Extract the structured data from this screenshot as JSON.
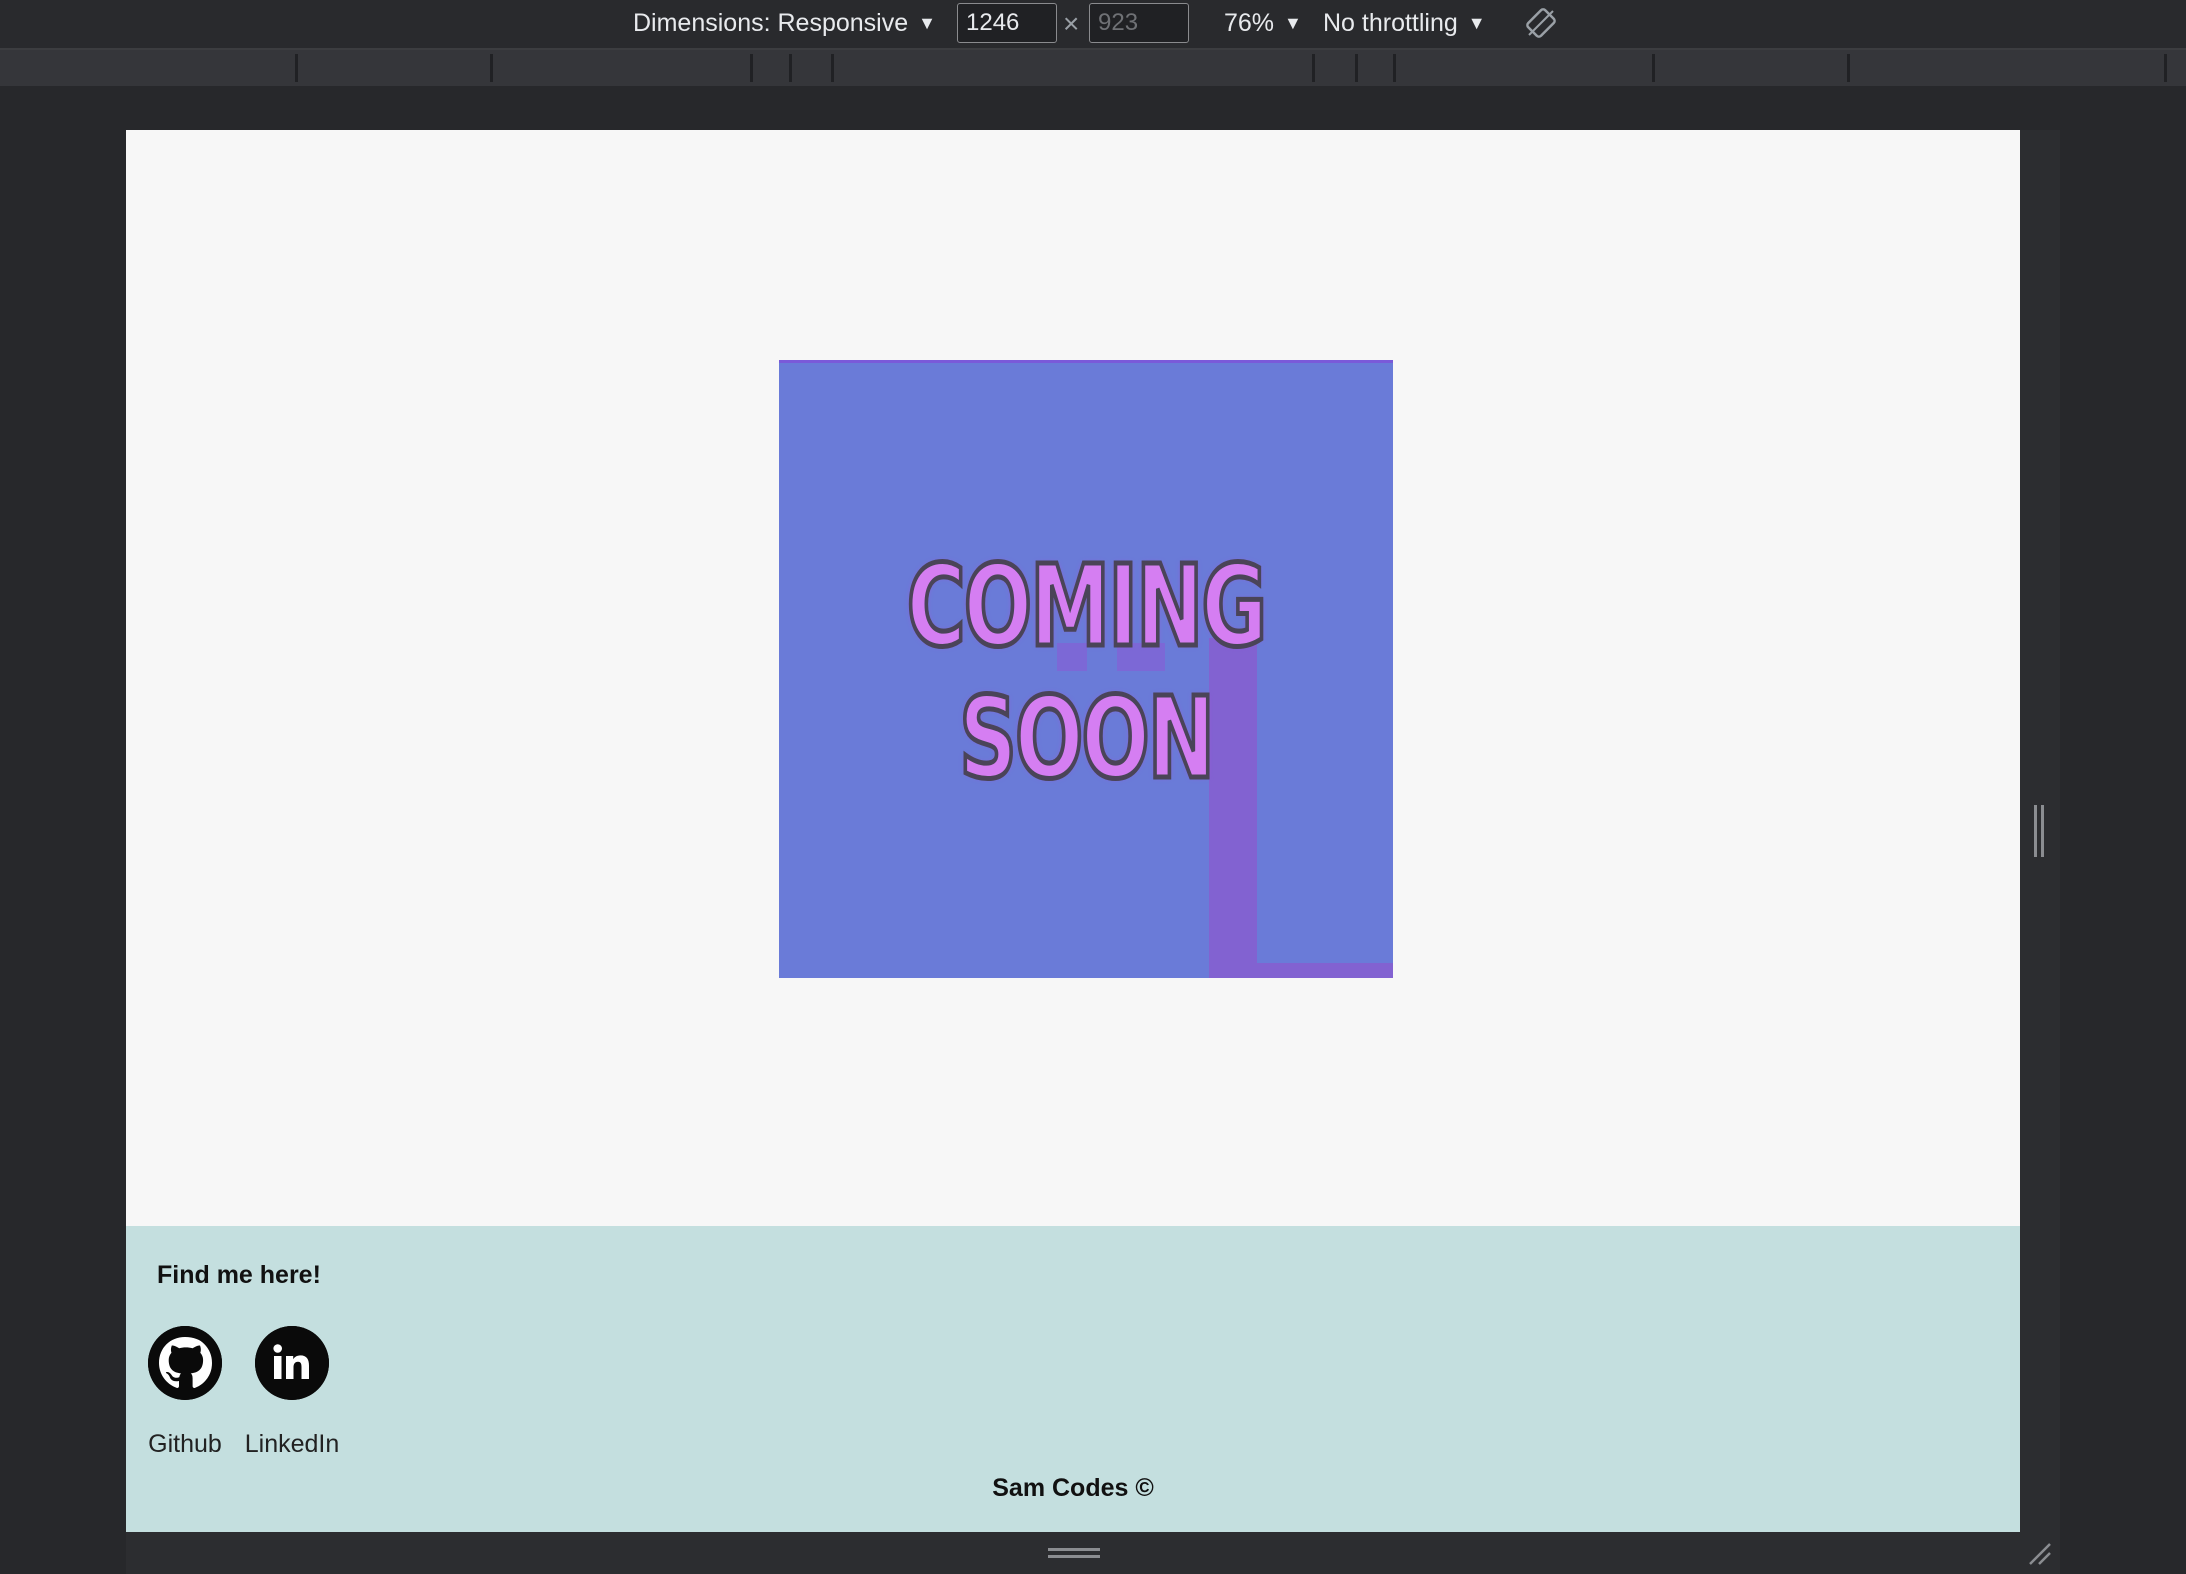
{
  "devtools": {
    "dimensions_label": "Dimensions: Responsive",
    "width_value": "1246",
    "height_placeholder": "923",
    "times_symbol": "×",
    "zoom_label": "76%",
    "throttling_label": "No throttling",
    "caret": "▼"
  },
  "page": {
    "hero": {
      "line1": "COMING",
      "line2": "SOON",
      "background_color": "#6a7bd8",
      "text_color": "#d57ef2"
    },
    "footer": {
      "heading": "Find me here!",
      "links": [
        {
          "label": "Github",
          "icon": "github-icon"
        },
        {
          "label": "LinkedIn",
          "icon": "linkedin-icon"
        }
      ],
      "copyright": "Sam Codes ©",
      "background_color": "#c4dfdf"
    }
  }
}
